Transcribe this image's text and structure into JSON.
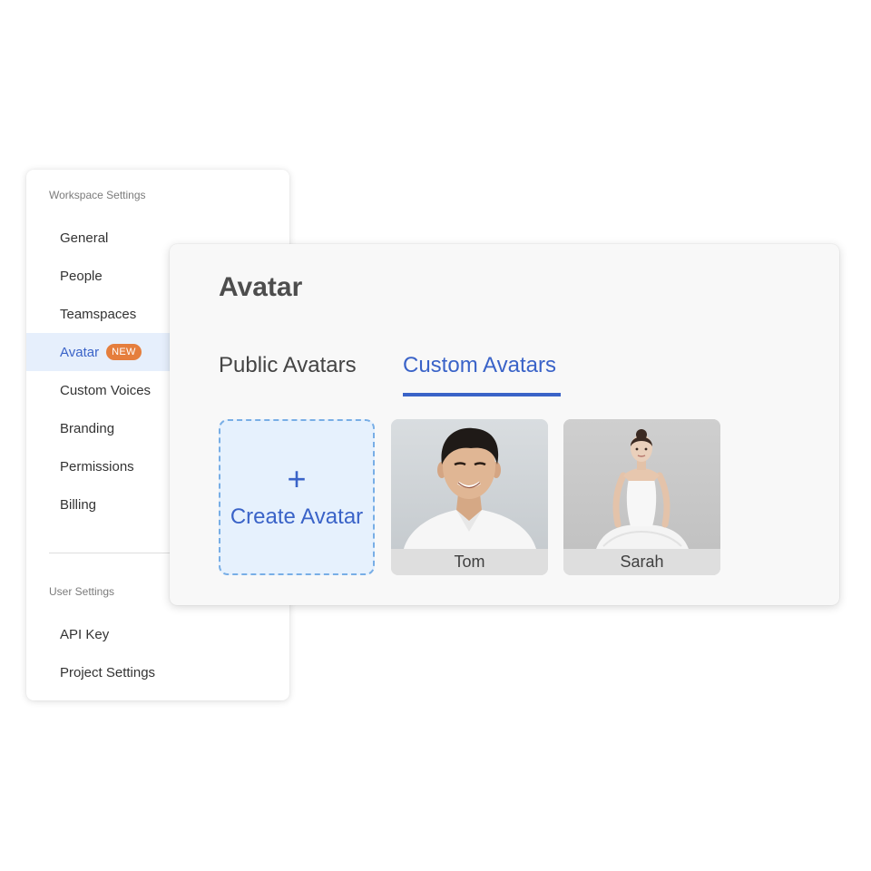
{
  "sidebar": {
    "workspace_title": "Workspace Settings",
    "workspace_items": [
      {
        "label": "General"
      },
      {
        "label": "People"
      },
      {
        "label": "Teamspaces"
      },
      {
        "label": "Avatar",
        "badge": "NEW",
        "active": true
      },
      {
        "label": "Custom Voices"
      },
      {
        "label": "Branding"
      },
      {
        "label": "Permissions"
      },
      {
        "label": "Billing"
      }
    ],
    "user_title": "User Settings",
    "user_items": [
      {
        "label": "API Key"
      },
      {
        "label": "Project Settings"
      }
    ]
  },
  "panel": {
    "title": "Avatar",
    "tabs": [
      {
        "label": "Public Avatars",
        "active": false
      },
      {
        "label": "Custom Avatars",
        "active": true
      }
    ],
    "create": {
      "icon": "plus-icon",
      "label": "Create Avatar"
    },
    "avatars": [
      {
        "name": "Tom"
      },
      {
        "name": "Sarah"
      }
    ]
  },
  "colors": {
    "accent": "#3a63c8",
    "badge": "#e57e3d",
    "active_bg": "#e6effc",
    "create_bg": "#e6f1fd",
    "create_border": "#78aee6"
  }
}
